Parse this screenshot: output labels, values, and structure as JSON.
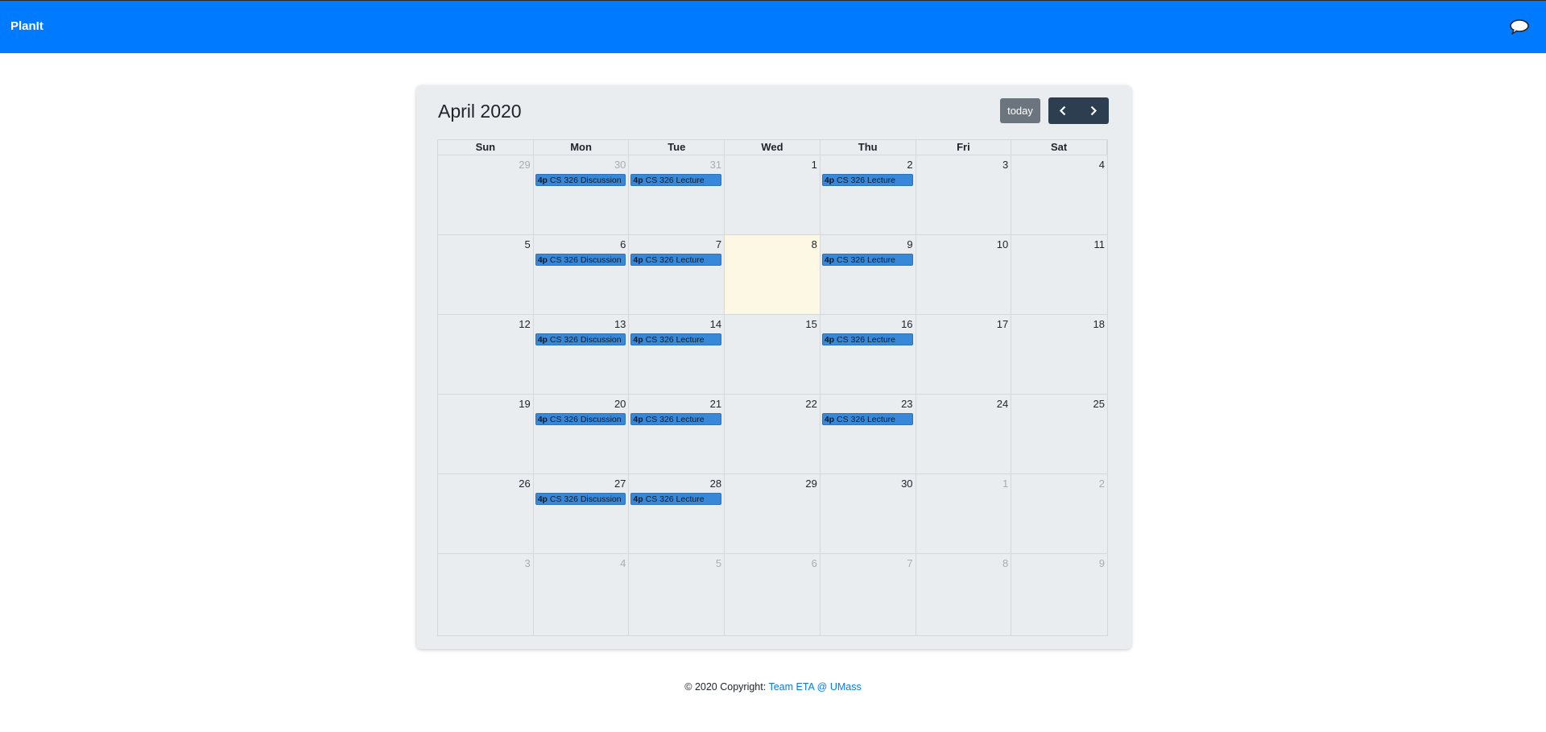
{
  "navbar": {
    "brand": "PlanIt",
    "user_icon": "user-chat-icon"
  },
  "calendar": {
    "title": "April 2020",
    "today_label": "today",
    "prev_icon": "chevron-left-icon",
    "next_icon": "chevron-right-icon",
    "weekdays": [
      "Sun",
      "Mon",
      "Tue",
      "Wed",
      "Thu",
      "Fri",
      "Sat"
    ],
    "weeks": [
      [
        {
          "num": "29",
          "other": true
        },
        {
          "num": "30",
          "other": true,
          "event": {
            "time": "4p",
            "title": "CS 326 Discussion"
          }
        },
        {
          "num": "31",
          "other": true,
          "event": {
            "time": "4p",
            "title": "CS 326 Lecture"
          }
        },
        {
          "num": "1"
        },
        {
          "num": "2",
          "event": {
            "time": "4p",
            "title": "CS 326 Lecture"
          }
        },
        {
          "num": "3"
        },
        {
          "num": "4"
        }
      ],
      [
        {
          "num": "5"
        },
        {
          "num": "6",
          "event": {
            "time": "4p",
            "title": "CS 326 Discussion"
          }
        },
        {
          "num": "7",
          "event": {
            "time": "4p",
            "title": "CS 326 Lecture"
          }
        },
        {
          "num": "8",
          "today": true
        },
        {
          "num": "9",
          "event": {
            "time": "4p",
            "title": "CS 326 Lecture"
          }
        },
        {
          "num": "10"
        },
        {
          "num": "11"
        }
      ],
      [
        {
          "num": "12"
        },
        {
          "num": "13",
          "event": {
            "time": "4p",
            "title": "CS 326 Discussion"
          }
        },
        {
          "num": "14",
          "event": {
            "time": "4p",
            "title": "CS 326 Lecture"
          }
        },
        {
          "num": "15"
        },
        {
          "num": "16",
          "event": {
            "time": "4p",
            "title": "CS 326 Lecture"
          }
        },
        {
          "num": "17"
        },
        {
          "num": "18"
        }
      ],
      [
        {
          "num": "19"
        },
        {
          "num": "20",
          "event": {
            "time": "4p",
            "title": "CS 326 Discussion"
          }
        },
        {
          "num": "21",
          "event": {
            "time": "4p",
            "title": "CS 326 Lecture"
          }
        },
        {
          "num": "22"
        },
        {
          "num": "23",
          "event": {
            "time": "4p",
            "title": "CS 326 Lecture"
          }
        },
        {
          "num": "24"
        },
        {
          "num": "25"
        }
      ],
      [
        {
          "num": "26"
        },
        {
          "num": "27",
          "event": {
            "time": "4p",
            "title": "CS 326 Discussion"
          }
        },
        {
          "num": "28",
          "event": {
            "time": "4p",
            "title": "CS 326 Lecture"
          }
        },
        {
          "num": "29"
        },
        {
          "num": "30"
        },
        {
          "num": "1",
          "other": true
        },
        {
          "num": "2",
          "other": true
        }
      ],
      [
        {
          "num": "3",
          "other": true
        },
        {
          "num": "4",
          "other": true
        },
        {
          "num": "5",
          "other": true
        },
        {
          "num": "6",
          "other": true
        },
        {
          "num": "7",
          "other": true
        },
        {
          "num": "8",
          "other": true
        },
        {
          "num": "9",
          "other": true
        }
      ]
    ]
  },
  "footer": {
    "copyright": "© 2020 Copyright: ",
    "link": "Team ETA @ UMass"
  },
  "colors": {
    "navbar": "#007bff",
    "event": "#3788d8",
    "today": "#fcf8e3",
    "nav_buttons": "#2c3e50",
    "today_button": "#6c757d"
  }
}
